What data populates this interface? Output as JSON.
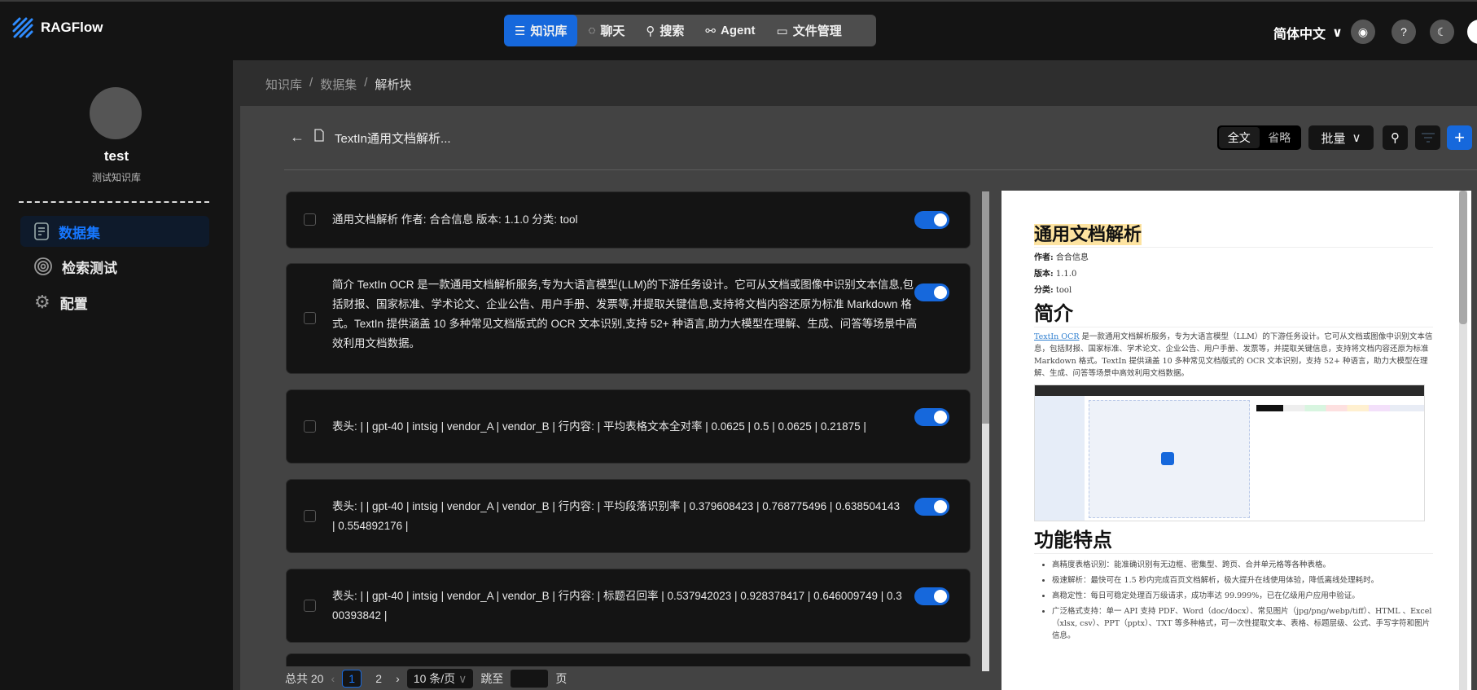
{
  "app": {
    "name": "RAGFlow"
  },
  "nav": {
    "items": [
      {
        "label": "知识库",
        "icon": "database-icon",
        "active": true
      },
      {
        "label": "聊天",
        "icon": "chat-icon"
      },
      {
        "label": "搜索",
        "icon": "search-icon"
      },
      {
        "label": "Agent",
        "icon": "agent-icon"
      },
      {
        "label": "文件管理",
        "icon": "folder-icon"
      }
    ]
  },
  "header": {
    "language": "简体中文"
  },
  "sidebar": {
    "kb_name": "test",
    "kb_desc": "测试知识库",
    "items": [
      {
        "label": "数据集",
        "active": true
      },
      {
        "label": "检索测试"
      },
      {
        "label": "配置"
      }
    ]
  },
  "breadcrumb": [
    "知识库",
    "数据集",
    "解析块"
  ],
  "toolbar": {
    "doc_title": "TextIn通用文档解析...",
    "full": "全文",
    "brief": "省略",
    "batch": "批量"
  },
  "chunks": [
    "通用文档解析 作者: 合合信息 版本: 1.1.0 分类: tool",
    "简介 TextIn OCR 是一款通用文档解析服务,专为大语言模型(LLM)的下游任务设计。它可从文档或图像中识别文本信息,包括财报、国家标准、学术论文、企业公告、用户手册、发票等,并提取关键信息,支持将文档内容还原为标准 Markdown 格式。TextIn 提供涵盖 10 多种常见文档版式的 OCR 文本识别,支持 52+ 种语言,助力大模型在理解、生成、问答等场景中高效利用文档数据。",
    "表头: | | gpt-40 | intsig | vendor_A | vendor_B | 行内容: | 平均表格文本全对率 | 0.0625 | 0.5 | 0.0625 | 0.21875 |",
    "表头: | | gpt-40 | intsig | vendor_A | vendor_B | 行内容: | 平均段落识别率 | 0.379608423 | 0.768775496 | 0.638504143 | 0.554892176 |",
    "表头: | | gpt-40 | intsig | vendor_A | vendor_B | 行内容: | 标题召回率 | 0.537942023 | 0.928378417 | 0.646009749 | 0.300393842 |"
  ],
  "chunk_enabled": [
    true,
    true,
    true,
    true,
    true
  ],
  "pagination": {
    "total": "总共 20",
    "pages": [
      "1",
      "2"
    ],
    "current": "1",
    "page_size": "10 条/页",
    "jump_label": "跳至",
    "page_suffix": "页"
  },
  "preview": {
    "title": "通用文档解析",
    "author_label": "作者:",
    "author": "合合信息",
    "version_label": "版本:",
    "version": "1.1.0",
    "category_label": "分类:",
    "category": "tool",
    "intro_heading": "简介",
    "intro_link": "TextIn OCR",
    "intro_text": " 是一款通用文档解析服务，专为大语言模型（LLM）的下游任务设计。它可从文档或图像中识别文本信息，包括财报、国家标准、学术论文、企业公告、用户手册、发票等，并提取关键信息，支持将文档内容还原为标准 Markdown 格式。TextIn 提供涵盖 10 多种常见文档版式的 OCR 文本识别，支持 52+ 种语言，助力大模型在理解、生成、问答等场景中高效利用文档数据。",
    "features_heading": "功能特点",
    "features": [
      "高精度表格识别：能准确识别有无边框、密集型、跨页、合并单元格等各种表格。",
      "极速解析：最快可在 1.5 秒内完成百页文档解析，极大提升在线使用体验，降低离线处理耗时。",
      "高稳定性：每日可稳定处理百万级请求，成功率达 99.999%，已在亿级用户应用中验证。",
      "广泛格式支持：单一 API 支持 PDF、Word（doc/docx）、常见图片（jpg/png/webp/tiff）、HTML 、Excel（xlsx, csv）、PPT（pptx）、TXT 等多种格式，可一次性提取文本、表格、标题层级、公式、手写字符和图片信息。"
    ]
  },
  "colors": {
    "accent": "#1668dc",
    "panel": "#434343",
    "card": "#141414"
  }
}
